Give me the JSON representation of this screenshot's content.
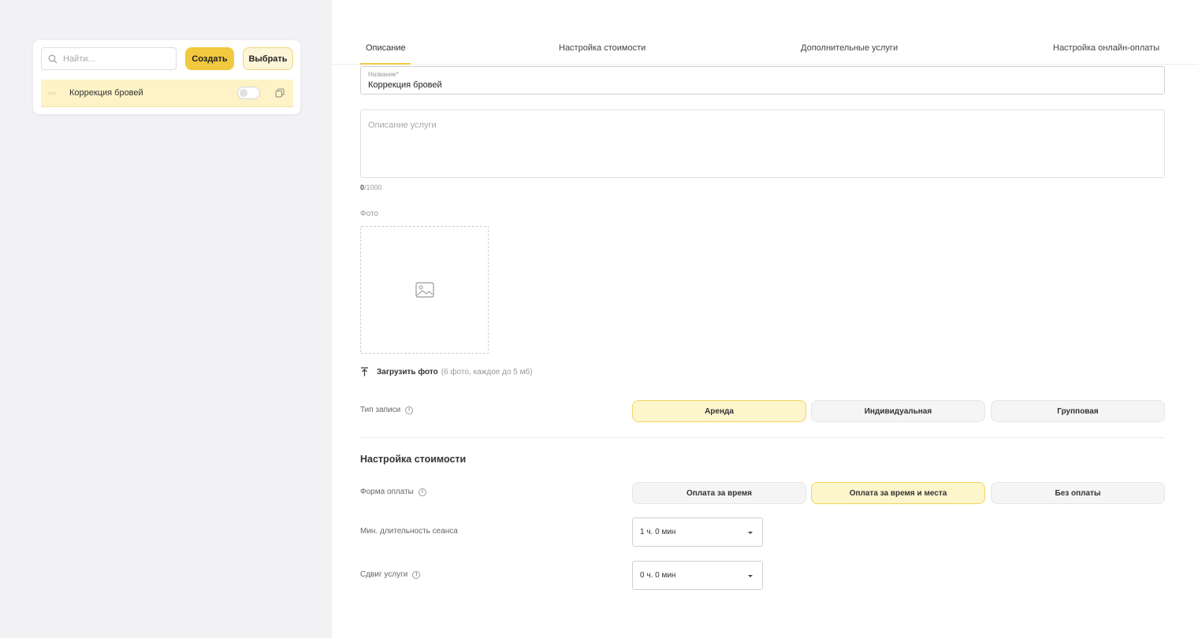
{
  "sidebar": {
    "search": {
      "placeholder": "Найти..."
    },
    "create_label": "Создать",
    "select_label": "Выбрать",
    "services": [
      {
        "name": "Коррекция бровей",
        "enabled": false
      }
    ]
  },
  "tabs": [
    {
      "label": "Описание",
      "active": true
    },
    {
      "label": "Настройка стоимости",
      "active": false
    },
    {
      "label": "Дополнительные услуги",
      "active": false
    },
    {
      "label": "Настройка онлайн-оплаты",
      "active": false
    }
  ],
  "form": {
    "name": {
      "label": "Название*",
      "value": "Коррекция бровей"
    },
    "description": {
      "placeholder": "Описание услуги",
      "counter_current": "0",
      "counter_max": "/1000"
    },
    "photo": {
      "label": "Фото",
      "upload_label": "Загрузить фото",
      "upload_hint": "(6 фото, каждое до 5 мб)"
    },
    "booking_type": {
      "label": "Тип записи",
      "options": [
        "Аренда",
        "Индивидуальная",
        "Групповая"
      ],
      "selected": "Аренда"
    }
  },
  "pricing": {
    "title": "Настройка стоимости",
    "payment_form": {
      "label": "Форма оплаты",
      "options": [
        "Оплата за время",
        "Оплата за время и места",
        "Без оплаты"
      ],
      "selected": "Оплата за время и места"
    },
    "min_duration": {
      "label": "Мин. длительность сеанса",
      "value": "1 ч. 0 мин"
    },
    "shift": {
      "label": "Сдвиг услуги",
      "value": "0 ч. 0 мин"
    }
  },
  "colors": {
    "accent": "#f1c93f",
    "accent_soft": "#fdf5cc",
    "sidebar_bg": "#f2f2f5"
  }
}
